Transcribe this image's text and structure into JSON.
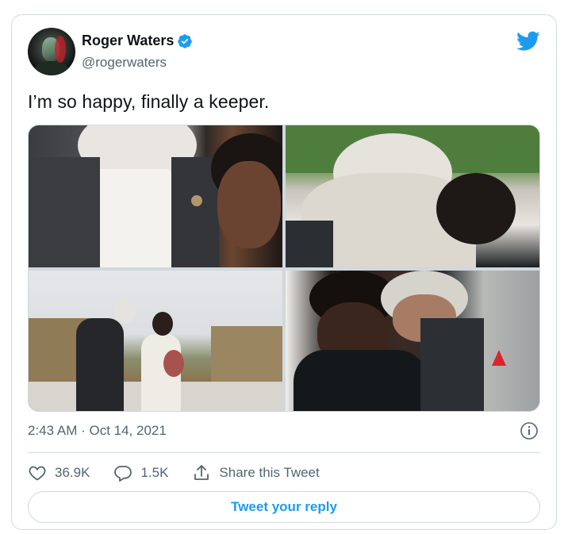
{
  "tweet": {
    "author_name": "Roger Waters",
    "author_handle": "@rogerwaters",
    "verified": true,
    "text": "I’m so happy, finally a keeper.",
    "timestamp": "2:43 AM · Oct 14, 2021",
    "photos_count": 4
  },
  "stats": {
    "likes": "36.9K",
    "replies": "1.5K",
    "share_label": "Share this Tweet"
  },
  "reply_button_label": "Tweet your reply",
  "colors": {
    "brand_blue": "#1d9bf0",
    "text_primary": "#0f1419",
    "text_secondary": "#536471",
    "border": "#cfd9de"
  },
  "icons": [
    "twitter-bird-icon",
    "verified-badge-icon",
    "info-icon",
    "heart-icon",
    "reply-bubble-icon",
    "share-icon"
  ]
}
